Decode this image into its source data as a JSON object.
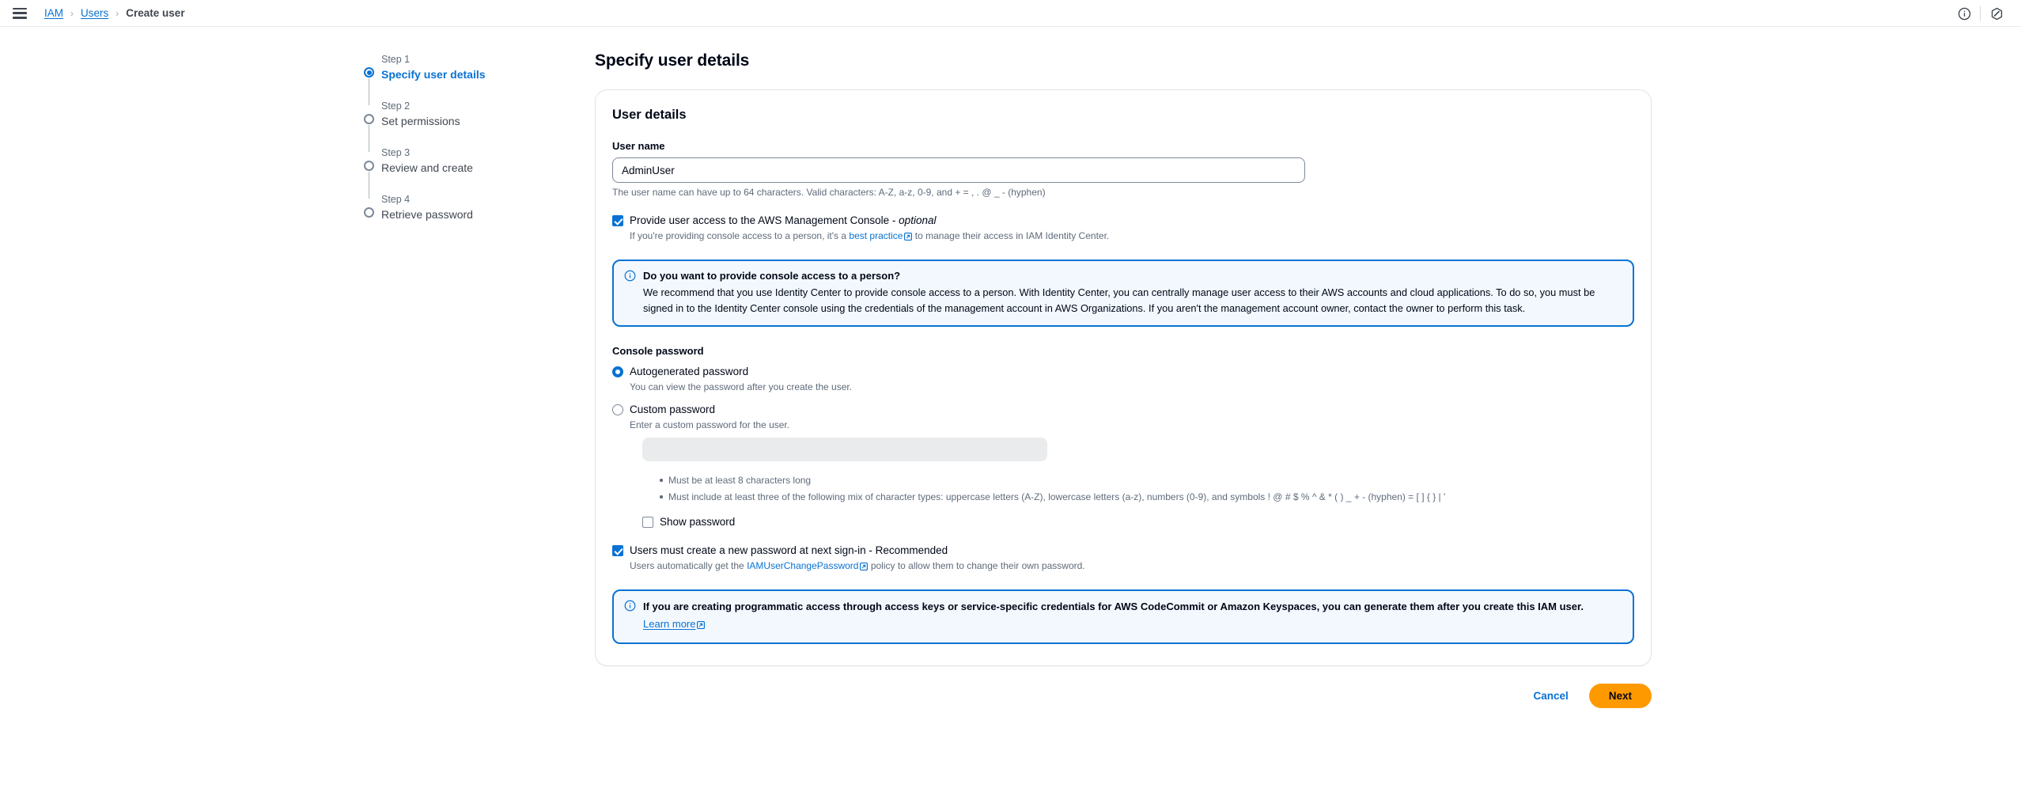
{
  "topbar": {
    "menu_icon": "hamburger-menu-icon",
    "breadcrumb": {
      "items": [
        {
          "label": "IAM",
          "type": "link"
        },
        {
          "label": "Users",
          "type": "link"
        },
        {
          "label": "Create user",
          "type": "current"
        }
      ],
      "separator": "›"
    },
    "right_icons": [
      {
        "name": "info-circle-icon"
      },
      {
        "name": "settings-shield-icon"
      }
    ]
  },
  "wizard": {
    "steps": [
      {
        "number": "Step 1",
        "title": "Specify user details",
        "state": "active"
      },
      {
        "number": "Step 2",
        "title": "Set permissions",
        "state": "pending"
      },
      {
        "number": "Step 3",
        "title": "Review and create",
        "state": "pending"
      },
      {
        "number": "Step 4",
        "title": "Retrieve password",
        "state": "pending"
      }
    ]
  },
  "main": {
    "page_title": "Specify user details",
    "card": {
      "title": "User details",
      "user_name": {
        "label": "User name",
        "value": "AdminUser",
        "placeholder": "",
        "hint": "The user name can have up to 64 characters. Valid characters: A-Z, a-z, 0-9, and + = , . @ _ - (hyphen)"
      },
      "console_access": {
        "checked": true,
        "label_main": "Provide user access to the AWS Management Console - ",
        "label_optional": "optional",
        "sub_prefix": "If you're providing console access to a person, it's a ",
        "sub_link": "best practice",
        "sub_suffix": " to manage their access in IAM Identity Center."
      },
      "identity_center_alert": {
        "icon": "info-circle-icon",
        "heading": "Do you want to provide console access to a person?",
        "body": "We recommend that you use Identity Center to provide console access to a person. With Identity Center, you can centrally manage user access to their AWS accounts and cloud applications. To do so, you must be signed in to the Identity Center console using the credentials of the management account in AWS Organizations. If you aren't the management account owner, contact the owner to perform this task."
      },
      "console_password": {
        "group_label": "Console password",
        "options": [
          {
            "label": "Autogenerated password",
            "sub": "You can view the password after you create the user.",
            "selected": true
          },
          {
            "label": "Custom password",
            "sub": "Enter a custom password for the user.",
            "selected": false
          }
        ],
        "password_input": {
          "value": "",
          "placeholder": "",
          "disabled": true
        },
        "rules": [
          "Must be at least 8 characters long",
          "Must include at least three of the following mix of character types: uppercase letters (A-Z), lowercase letters (a-z), numbers (0-9), and symbols ! @ # $ % ^ & * ( ) _ + - (hyphen) = [ ] { } | '"
        ],
        "show_password": {
          "label": "Show password",
          "checked": false
        }
      },
      "must_change_password": {
        "checked": true,
        "label": "Users must create a new password at next sign-in - Recommended",
        "sub_prefix": "Users automatically get the ",
        "sub_link": "IAMUserChangePassword",
        "sub_suffix": " policy to allow them to change their own password."
      },
      "programmatic_alert": {
        "icon": "info-circle-icon",
        "text": "If you are creating programmatic access through access keys or service-specific credentials for AWS CodeCommit or Amazon Keyspaces, you can generate them after you create this IAM user.",
        "link": "Learn more"
      }
    },
    "actions": {
      "cancel_label": "Cancel",
      "next_label": "Next"
    }
  },
  "colors": {
    "accent_blue": "#0972d3",
    "action_orange": "#ff9900",
    "text_default": "#000716",
    "text_secondary": "#5f6b7a",
    "alert_bg": "#f2f8fd",
    "disabled_bg": "#e9ebed"
  }
}
